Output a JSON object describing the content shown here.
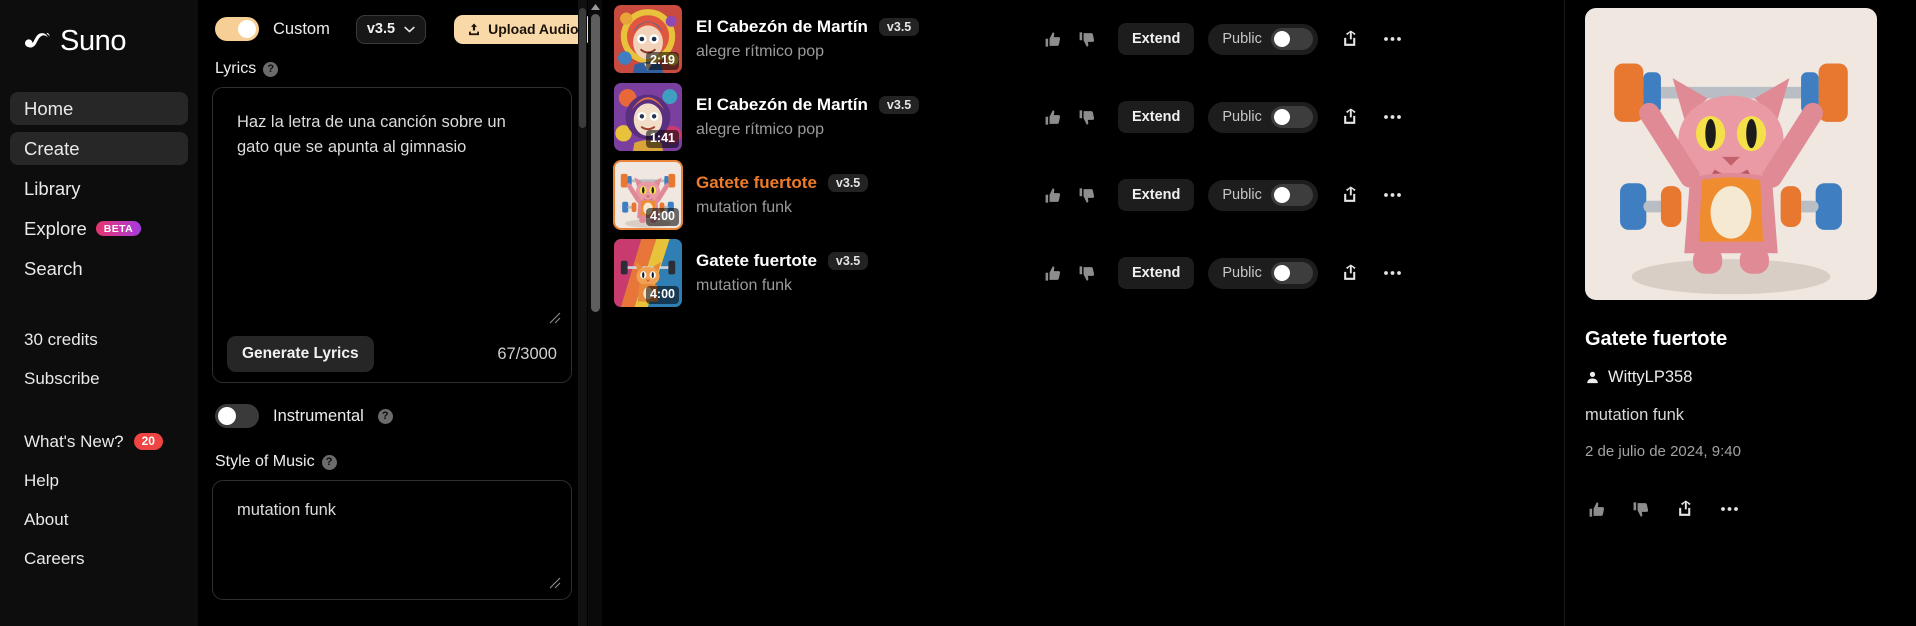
{
  "brand": {
    "name": "Suno",
    "logo_icon": "suno-logo-icon"
  },
  "sidebar": {
    "nav": [
      {
        "label": "Home",
        "name": "home",
        "active": false
      },
      {
        "label": "Create",
        "name": "create",
        "active": true
      },
      {
        "label": "Library",
        "name": "library",
        "active": false
      },
      {
        "label": "Explore",
        "name": "explore",
        "active": false,
        "badge": "BETA"
      },
      {
        "label": "Search",
        "name": "search",
        "active": false
      }
    ],
    "credits": [
      {
        "label": "30 credits",
        "name": "credits"
      },
      {
        "label": "Subscribe",
        "name": "subscribe"
      }
    ],
    "bottom": [
      {
        "label": "What's New?",
        "name": "whats-new",
        "count": "20"
      },
      {
        "label": "Help",
        "name": "help"
      },
      {
        "label": "About",
        "name": "about"
      },
      {
        "label": "Careers",
        "name": "careers"
      }
    ]
  },
  "create": {
    "custom_toggle": {
      "label": "Custom",
      "on": true
    },
    "version": {
      "value": "v3.5",
      "icon": "chevron-down-icon"
    },
    "upload": {
      "label": "Upload Audio",
      "icon": "upload-icon"
    },
    "lyrics": {
      "label": "Lyrics",
      "help_icon": "help-icon",
      "value": "Haz la letra de una canción sobre un gato que se apunta al gimnasio",
      "generate_label": "Generate Lyrics",
      "char_count": "67/3000"
    },
    "instrumental": {
      "label": "Instrumental",
      "on": false,
      "help_icon": "help-icon"
    },
    "style": {
      "label": "Style of Music",
      "help_icon": "help-icon",
      "value": "mutation funk"
    }
  },
  "songs": [
    {
      "title": "El Cabezón de Martín",
      "style": "alegre rítmico pop",
      "version": "v3.5",
      "duration": "2:19",
      "selected": false,
      "art": "clown-face-blue-hair",
      "extend_label": "Extend",
      "public_label": "Public",
      "public_on": false
    },
    {
      "title": "El Cabezón de Martín",
      "style": "alegre rítmico pop",
      "version": "v3.5",
      "duration": "1:41",
      "selected": false,
      "art": "clown-face-orange-hair",
      "extend_label": "Extend",
      "public_label": "Public",
      "public_on": false
    },
    {
      "title": "Gatete fuertote",
      "style": "mutation funk",
      "version": "v3.5",
      "duration": "4:00",
      "selected": true,
      "art": "cat-weightlifter-pink",
      "extend_label": "Extend",
      "public_label": "Public",
      "public_on": false
    },
    {
      "title": "Gatete fuertote",
      "style": "mutation funk",
      "version": "v3.5",
      "duration": "4:00",
      "selected": false,
      "art": "cat-weightlifter-orange",
      "extend_label": "Extend",
      "public_label": "Public",
      "public_on": false
    }
  ],
  "detail": {
    "title": "Gatete fuertote",
    "user": "WittyLP358",
    "user_icon": "person-icon",
    "style": "mutation funk",
    "date": "2 de julio de 2024, 9:40",
    "actions": [
      "thumbs-up-icon",
      "thumbs-down-icon",
      "share-icon",
      "more-icon"
    ]
  },
  "colors": {
    "accent_orange": "#ec7b2b",
    "accent_peach": "#fad9a9",
    "badge_red": "#ef4444",
    "sidebar_bg": "#0d0d0d",
    "bg": "#000000"
  }
}
